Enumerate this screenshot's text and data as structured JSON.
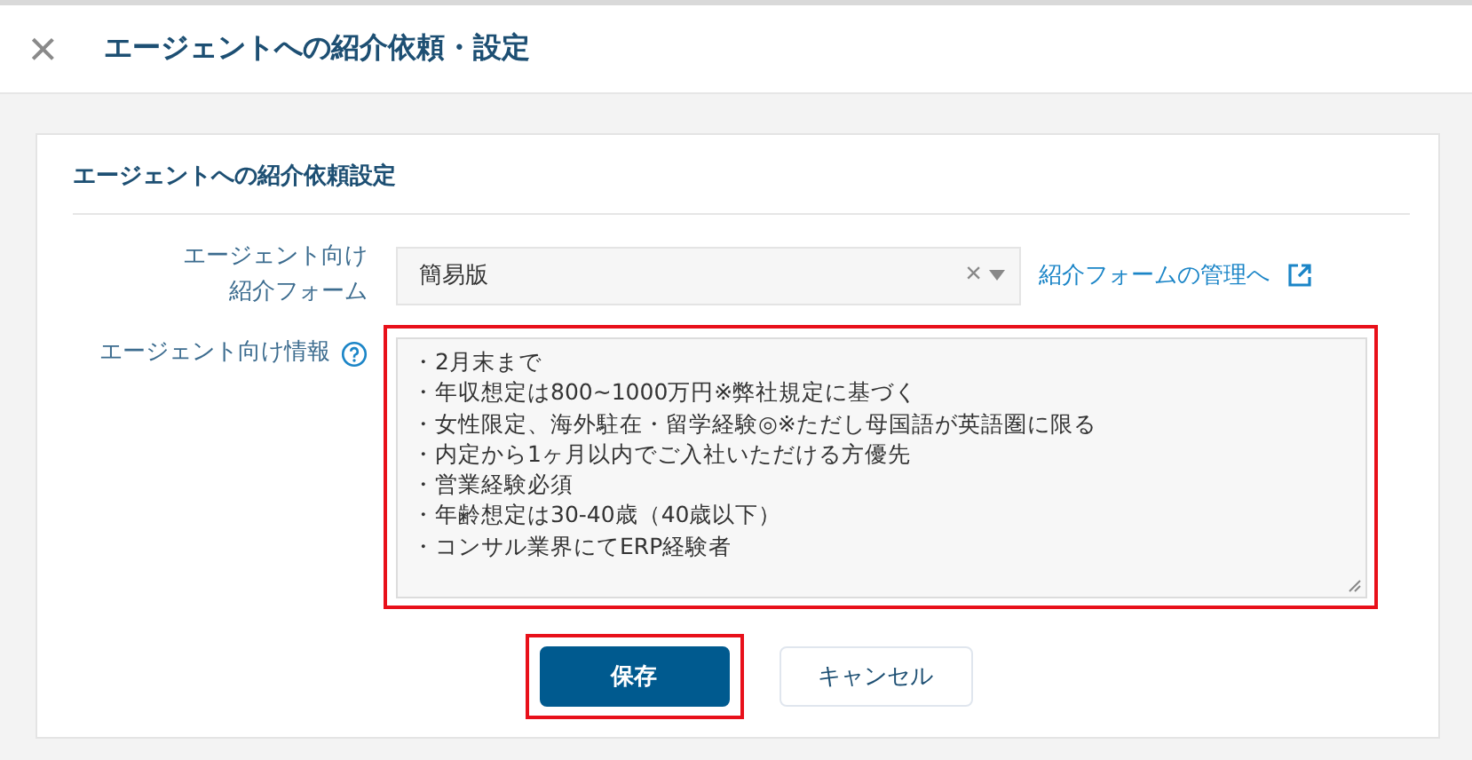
{
  "header": {
    "close": "×",
    "title": "エージェントへの紹介依頼・設定"
  },
  "section": {
    "title": "エージェントへの紹介依頼設定"
  },
  "form_field": {
    "label_lines": [
      "エージェント向け",
      "紹介フォーム"
    ],
    "value": "簡易版",
    "clear": "×",
    "link": "紹介フォームの管理へ"
  },
  "info_field": {
    "label": "エージェント向け情報",
    "highlighted": true,
    "lines": [
      "・2月末まで",
      "・年収想定は800~1000万円※弊社規定に基づく",
      "・女性限定、海外駐在・留学経験◎※ただし母国語が英語圏に限る",
      "・内定から1ヶ月以内でご入社いただける方優先",
      "・営業経験必須",
      "・年齢想定は30-40歳（40歳以下）",
      "・コンサル業界にてERP経験者"
    ]
  },
  "buttons": [
    {
      "label": "保存",
      "kind": "primary",
      "highlighted": true
    },
    {
      "label": "キャンセル",
      "kind": "secondary",
      "highlighted": false
    }
  ]
}
